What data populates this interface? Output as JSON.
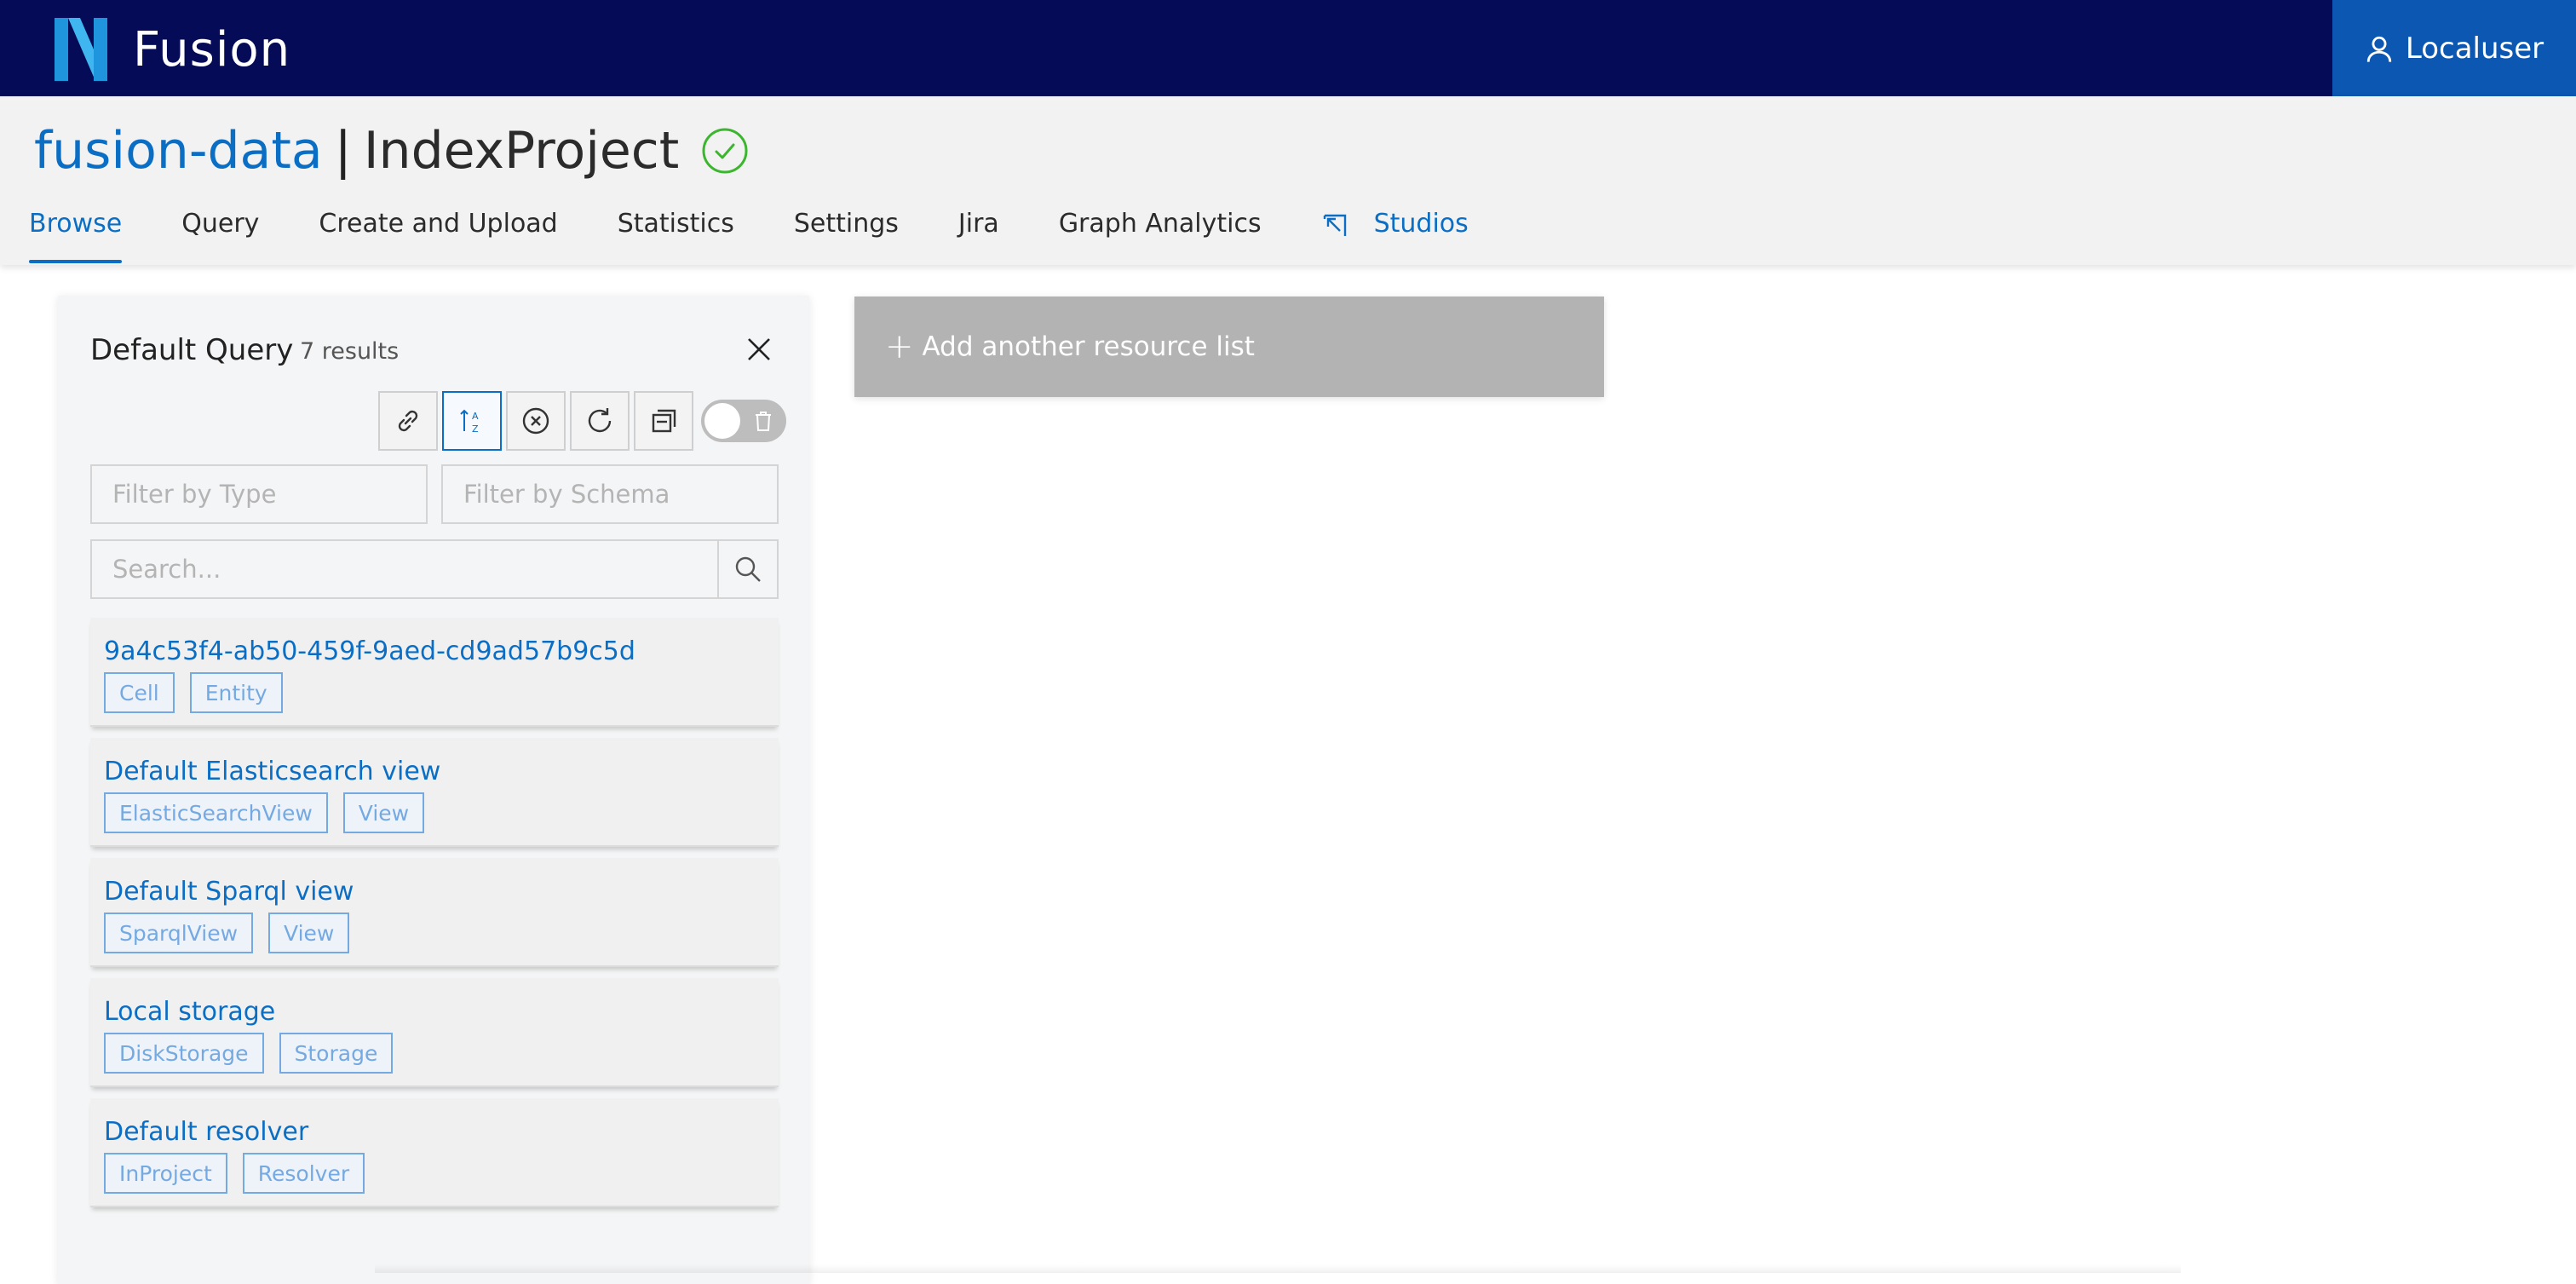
{
  "app": {
    "name": "Fusion",
    "user_label": "Localuser"
  },
  "header": {
    "org": "fusion-data",
    "separator": "|",
    "project": "IndexProject"
  },
  "nav": {
    "browse": "Browse",
    "query": "Query",
    "create_upload": "Create and Upload",
    "statistics": "Statistics",
    "settings": "Settings",
    "jira": "Jira",
    "graph_analytics": "Graph Analytics",
    "studios": "Studios",
    "active": "Browse"
  },
  "panel": {
    "title": "Default Query",
    "count": "7 results",
    "filter_type_placeholder": "Filter by Type",
    "filter_schema_placeholder": "Filter by Schema",
    "search_placeholder": "Search...",
    "results": [
      {
        "title": "9a4c53f4-ab50-459f-9aed-cd9ad57b9c5d",
        "tags": [
          "Cell",
          "Entity"
        ]
      },
      {
        "title": "Default Elasticsearch view",
        "tags": [
          "ElasticSearchView",
          "View"
        ]
      },
      {
        "title": "Default Sparql view",
        "tags": [
          "SparqlView",
          "View"
        ]
      },
      {
        "title": "Local storage",
        "tags": [
          "DiskStorage",
          "Storage"
        ]
      },
      {
        "title": "Default resolver",
        "tags": [
          "InProject",
          "Resolver"
        ]
      }
    ]
  },
  "add_list": {
    "label": "Add another resource list"
  },
  "colors": {
    "topbar": "#050b56",
    "user_button": "#0b57b1",
    "accent": "#0b6ec5",
    "status_ok": "#3cb52f",
    "tag_border": "#74a9e2",
    "add_list_bg": "#b3b3b3"
  }
}
